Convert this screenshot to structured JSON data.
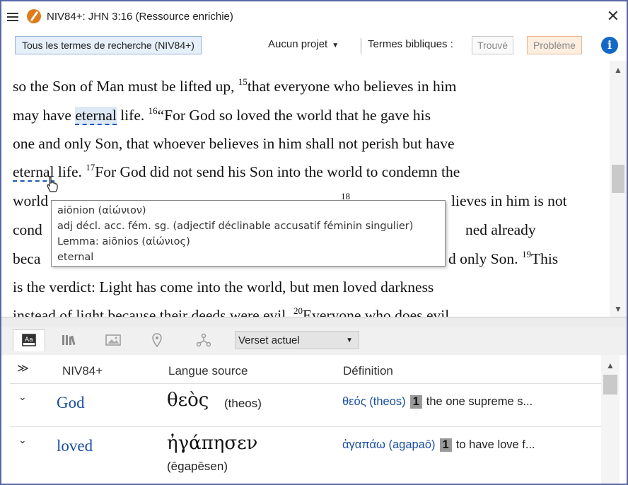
{
  "window": {
    "title": "NIV84+: JHN 3:16 (Ressource enrichie)"
  },
  "toolbar": {
    "search_terms": "Tous les termes de recherche (NIV84+)",
    "project": "Aucun projet",
    "terms_label": "Termes bibliques :",
    "found": "Trouvé",
    "problem": "Problème"
  },
  "text": {
    "l1a": "so the Son of Man must be lifted up, ",
    "v15": "15",
    "l1b": "that everyone who believes in him",
    "l2a": "may have ",
    "l2w": "eternal",
    "l2b": " life. ",
    "v16": "16",
    "l2c": "“For God so loved the world that he gave his",
    "l3": "one and only Son, that whoever believes in him shall not perish but have",
    "l4w": "eternal",
    "l4a": " life. ",
    "v17": "17",
    "l4b": "For God did not send his Son into the world to condemn the",
    "l5a": "world",
    "v18": "18",
    "l5b": "lieves in him is not",
    "l6a": "cond",
    "l6b": "ned already",
    "l7a": "beca",
    "l7b": "d only Son. ",
    "v19": "19",
    "l7c": "This",
    "l8": "is the verdict: Light has come into the world, but men loved darkness",
    "l9a": "instead of light because their deeds were evil. ",
    "v20": "20",
    "l9b": "Everyone who does evil"
  },
  "tooltip": {
    "line1": "aiōnion (αἰώνιον)",
    "line2": "adj décl. acc. fém. sg. (adjectif déclinable accusatif féminin singulier)",
    "line3": "Lemma: aiōnios (αἰώνιος)",
    "line4": "eternal"
  },
  "panel": {
    "verse_select": "Verset actuel",
    "tabs": [
      "text-icon",
      "library-icon",
      "image-icon",
      "location-icon",
      "network-icon"
    ]
  },
  "table": {
    "headers": {
      "col1": "NIV84+",
      "col2": "Langue source",
      "col3": "Définition"
    },
    "rows": [
      {
        "word": "God",
        "greek": "θεὸς",
        "translit": "(theos)",
        "lemma": "θεός (theos)",
        "sense": "1",
        "definition": "the one supreme s..."
      },
      {
        "word": "loved",
        "greek": "ἠγάπησεν",
        "translit": "(ēgapēsen)",
        "lemma": "ἀγαπάω (agapaō)",
        "sense": "1",
        "definition": "to have love f..."
      }
    ]
  }
}
